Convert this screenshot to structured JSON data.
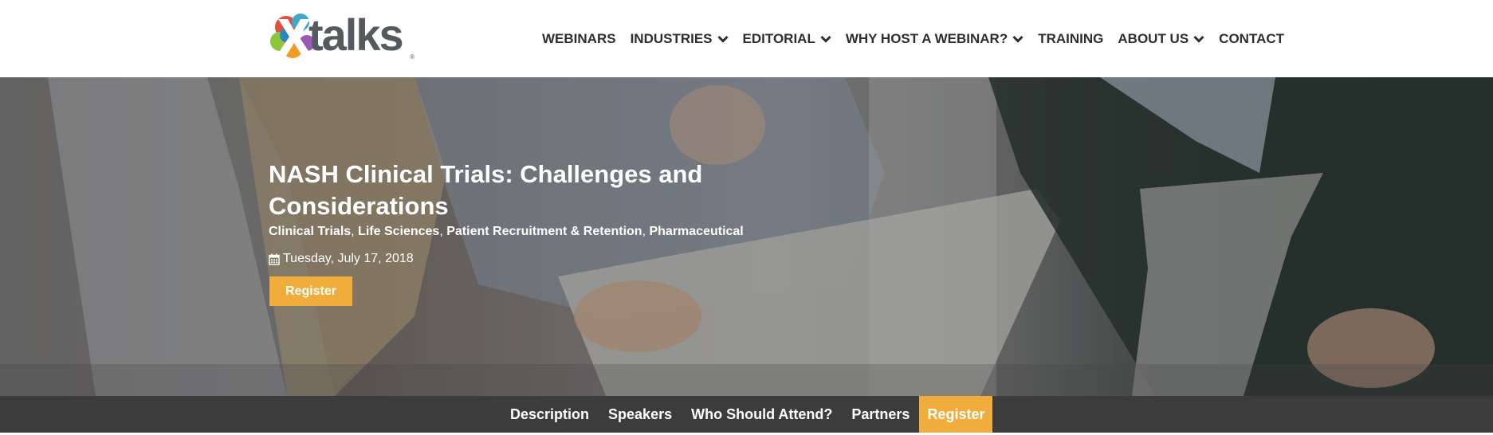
{
  "header": {
    "logo": {
      "text": "talks",
      "registered": "®"
    },
    "nav": [
      {
        "label": "WEBINARS",
        "dropdown": false
      },
      {
        "label": "INDUSTRIES",
        "dropdown": true
      },
      {
        "label": "EDITORIAL",
        "dropdown": true
      },
      {
        "label": "WHY HOST A WEBINAR?",
        "dropdown": true
      },
      {
        "label": "TRAINING",
        "dropdown": false
      },
      {
        "label": "ABOUT US",
        "dropdown": true
      },
      {
        "label": "CONTACT",
        "dropdown": false
      }
    ]
  },
  "hero": {
    "title": "NASH Clinical Trials: Challenges and Considerations",
    "tags": [
      "Clinical Trials",
      "Life Sciences",
      "Patient Recruitment & Retention",
      "Pharmaceutical"
    ],
    "tag_separator": ",",
    "date": "Tuesday, July 17, 2018",
    "date_icon": "calendar-icon",
    "register_label": "Register"
  },
  "subnav": {
    "items": [
      {
        "label": "Description",
        "active": false
      },
      {
        "label": "Speakers",
        "active": false
      },
      {
        "label": "Who Should Attend?",
        "active": false
      },
      {
        "label": "Partners",
        "active": false
      },
      {
        "label": "Register",
        "active": true
      }
    ]
  },
  "colors": {
    "accent": "#f0ad3c",
    "nav_text": "#2e2e2e",
    "subnav_bg": "#3c3c3c",
    "logo_text": "#555a60"
  }
}
